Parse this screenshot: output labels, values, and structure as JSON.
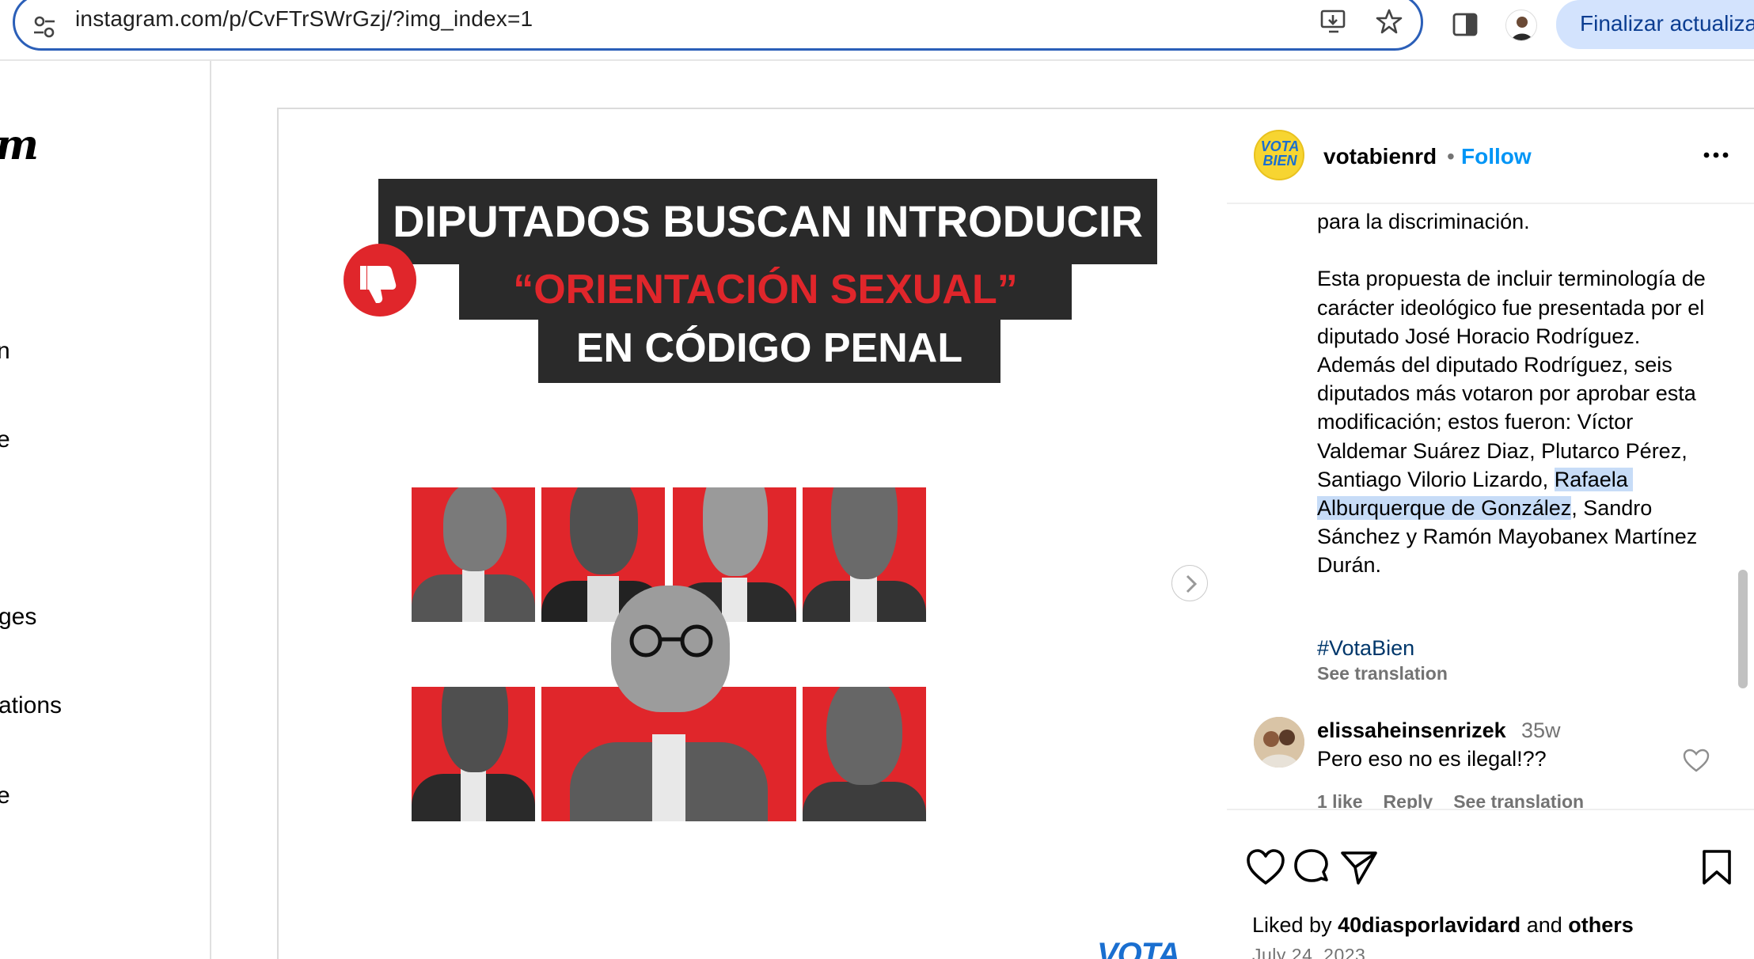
{
  "browser": {
    "url": "instagram.com/p/CvFTrSWrGzj/?img_index=1",
    "update_button": "Finalizar actualiza"
  },
  "leftnav": {
    "logo_fragment": "m",
    "items": [
      "n",
      "e",
      "ges",
      "ations",
      "e"
    ]
  },
  "media": {
    "headline_line1": "DIPUTADOS BUSCAN INTRODUCIR",
    "headline_line2": "“ORIENTACIÓN SEXUAL”",
    "headline_line3": "EN CÓDIGO PENAL",
    "watermark": "VOTA",
    "accent_color": "#e0262b"
  },
  "post": {
    "avatar_text": "VOTA BIEN",
    "username": "votabienrd",
    "separator": "•",
    "follow_label": "Follow",
    "caption_before": "para la discriminación.\n\nEsta propuesta de incluir terminología de carácter ideológico fue presentada por el diputado José Horacio Rodríguez. Además del diputado Rodríguez, seis diputados más votaron por aprobar esta modificación; estos fueron: Víctor Valdemar Suárez Diaz, Plutarco Pérez, Santiago Vilorio Lizardo, ",
    "caption_highlight": "Rafaela Alburquerque de González",
    "caption_after": ", Sandro Sánchez y Ramón Mayobanex Martínez Durán.",
    "hashtag": "#VotaBien",
    "see_translation": "See translation",
    "comment": {
      "user": "elissaheinsenrizek",
      "time": "35w",
      "text": "Pero eso no es ilegal!??",
      "likes": "1 like",
      "reply": "Reply",
      "see_translation": "See translation"
    },
    "liked_by_prefix": "Liked by ",
    "liked_by_user": "40diasporlavidard",
    "liked_by_and": " and ",
    "liked_by_others": "others",
    "date": "July 24, 2023"
  }
}
